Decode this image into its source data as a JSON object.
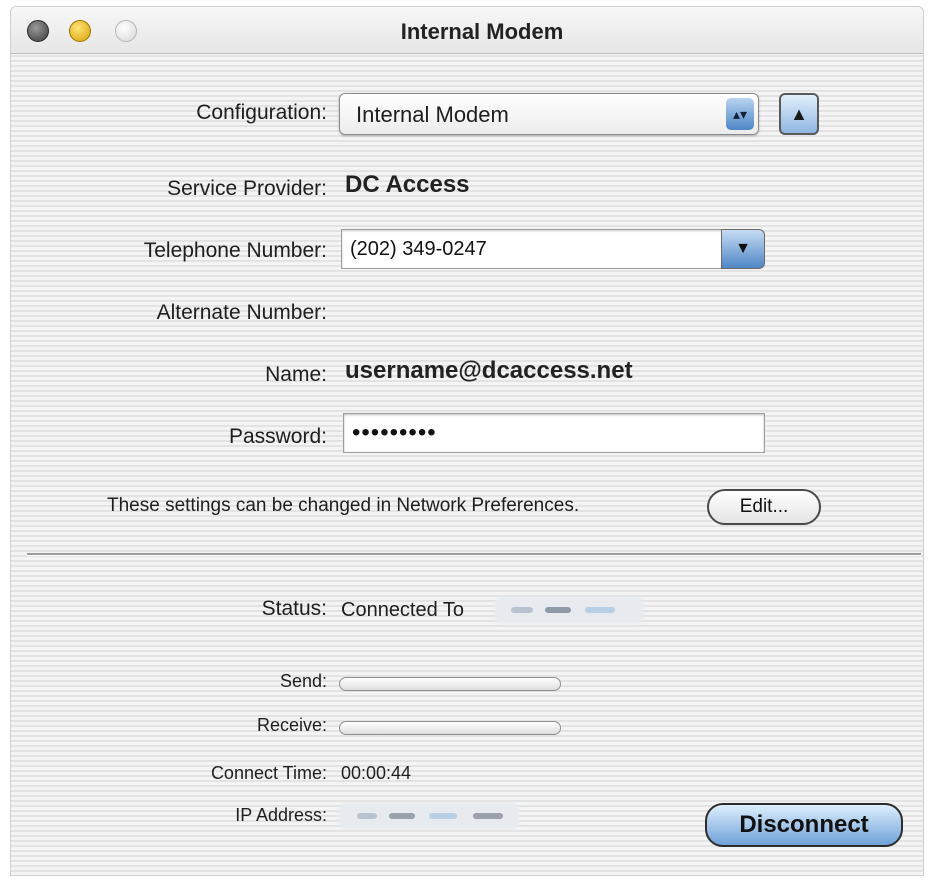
{
  "window": {
    "title": "Internal Modem"
  },
  "form": {
    "configuration_label": "Configuration:",
    "configuration_value": "Internal Modem",
    "service_provider_label": "Service Provider:",
    "service_provider_value": "DC Access",
    "telephone_label": "Telephone Number:",
    "telephone_value": "(202) 349-0247",
    "alternate_label": "Alternate Number:",
    "alternate_value": "",
    "name_label": "Name:",
    "name_value": "username@dcaccess.net",
    "password_label": "Password:",
    "password_value": "•••••••••",
    "note": "These settings can be changed in Network Preferences.",
    "edit_button": "Edit..."
  },
  "status": {
    "status_label": "Status:",
    "status_value": "Connected To",
    "send_label": "Send:",
    "send_level": 0,
    "receive_label": "Receive:",
    "receive_level": 0,
    "connect_time_label": "Connect Time:",
    "connect_time_value": "00:00:44",
    "ip_label": "IP Address:",
    "disconnect_button": "Disconnect"
  },
  "icons": {
    "close": "close-button-icon",
    "minimize": "minimize-button-icon",
    "zoom": "zoom-button-icon",
    "popup_arrows": "up-down-arrows-icon",
    "combo_arrow": "chevron-down-icon",
    "eject": "triangle-up-icon"
  },
  "colors": {
    "accent": "#4f86c6",
    "window_bg": "#f2f2f2"
  }
}
